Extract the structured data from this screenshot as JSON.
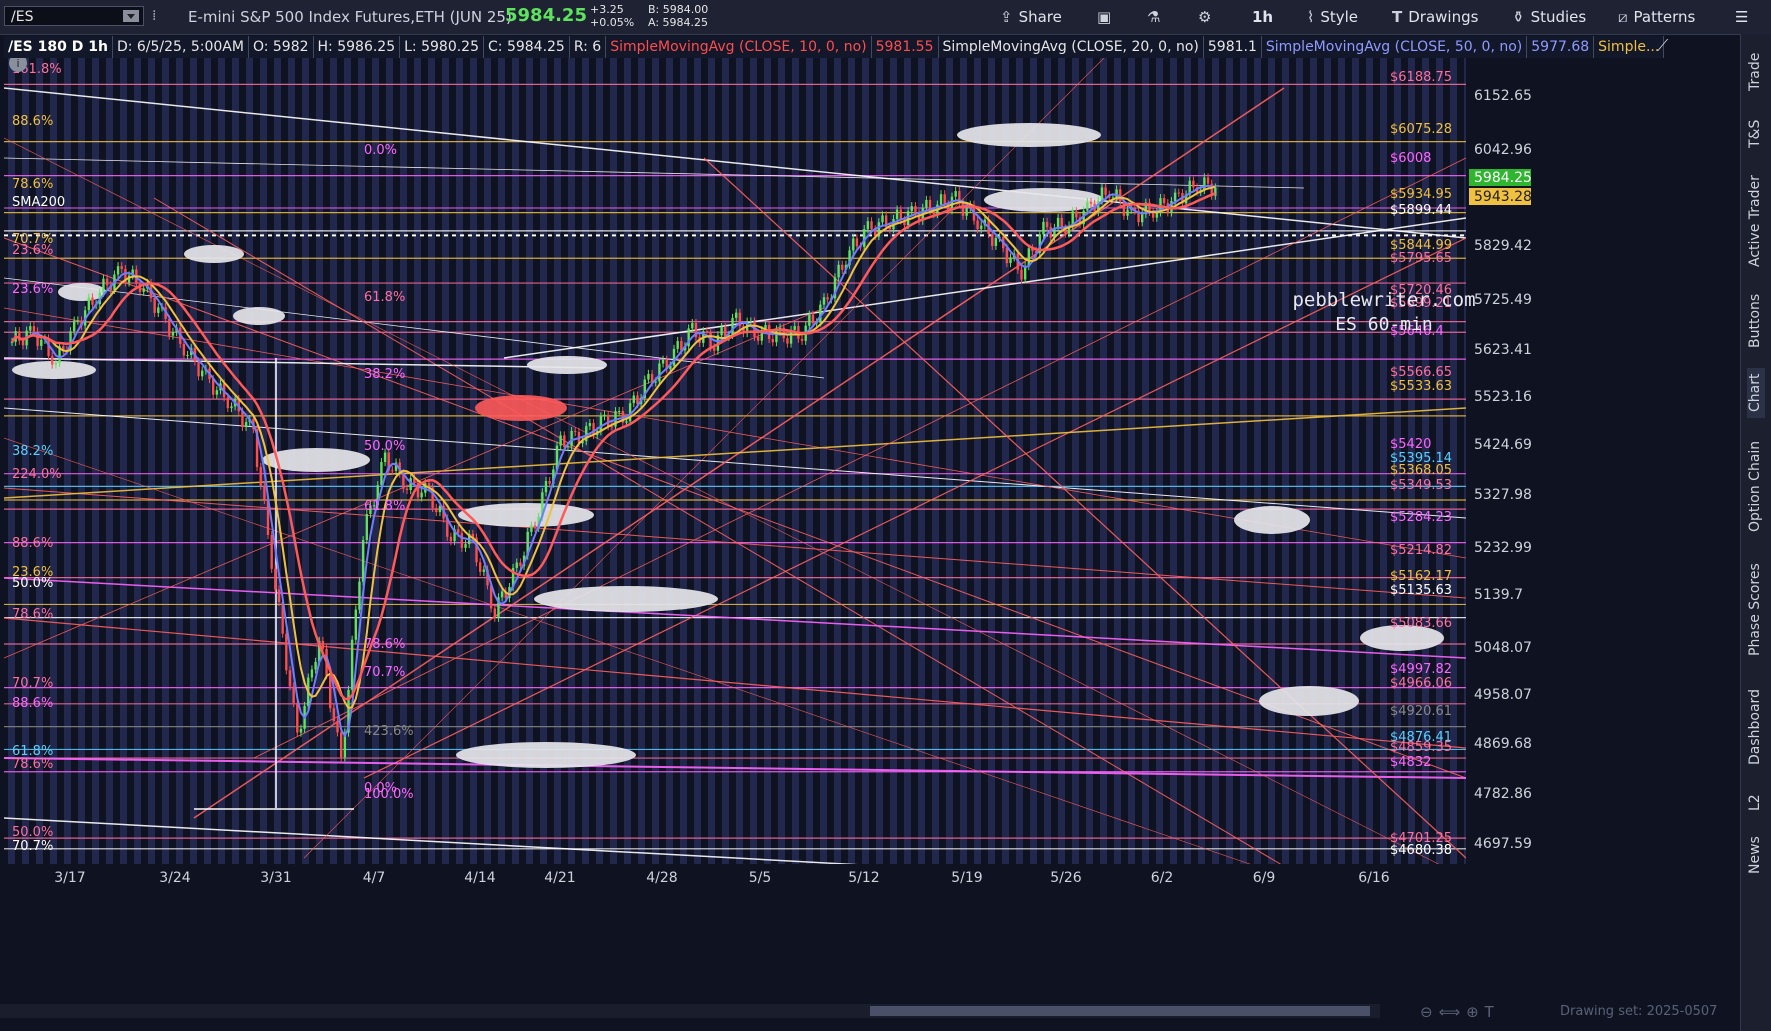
{
  "toolbar": {
    "symbol": "/ES",
    "description": "E-mini S&P 500 Index Futures,ETH (JUN 25)",
    "last_price": "5984.25",
    "change_abs": "+3.25",
    "change_pct": "+0.05%",
    "bid": "B: 5984.00",
    "ask": "A: 5984.25",
    "share_label": "Share",
    "interval_label": "1h",
    "style_label": "Style",
    "drawings_label": "Drawings",
    "studies_label": "Studies",
    "patterns_label": "Patterns"
  },
  "infobar": {
    "name": "/ES 180 D 1h",
    "date": "D: 6/5/25, 5:00AM",
    "open": "O: 5982",
    "high": "H: 5986.25",
    "low": "L: 5980.25",
    "close": "C: 5984.25",
    "range": "R: 6",
    "sma10_label": "SimpleMovingAvg (CLOSE, 10, 0, no)",
    "sma10_value": "5981.55",
    "sma20_label": "SimpleMovingAvg (CLOSE, 20, 0, no)",
    "sma20_value": "5981.1",
    "sma50_label": "SimpleMovingAvg (CLOSE, 50, 0, no)",
    "sma50_value": "5977.68",
    "sma_more": "Simple..."
  },
  "chart": {
    "watermark_1": "pebblewriter.com",
    "watermark_2": "ES 60-min",
    "price_labels": [
      "6152.65",
      "6042.96",
      "5829.42",
      "5725.49",
      "5623.41",
      "5523.16",
      "5424.69",
      "5327.98",
      "5232.99",
      "5139.7",
      "5048.07",
      "4958.07",
      "4869.68",
      "4782.86",
      "4697.59"
    ],
    "date_labels": [
      "3/17",
      "3/24",
      "3/31",
      "4/7",
      "4/14",
      "4/21",
      "4/28",
      "5/5",
      "5/12",
      "5/19",
      "5/26",
      "6/2",
      "6/9",
      "6/16"
    ],
    "current_price_tag": "5984.25",
    "sma_tag": "5943.28",
    "level_labels": [
      {
        "t": "$6188.75",
        "c": "#ff6fa0"
      },
      {
        "t": "$6075.28",
        "c": "#f0c040"
      },
      {
        "t": "$6008",
        "c": "#ff66ff"
      },
      {
        "t": "$5934.95",
        "c": "#f0c040"
      },
      {
        "t": "$5899.44",
        "c": "#ffffff"
      },
      {
        "t": "$5844.99",
        "c": "#f0c040"
      },
      {
        "t": "$5795.65",
        "c": "#ff6fa0"
      },
      {
        "t": "$5720.46",
        "c": "#ff6fa0"
      },
      {
        "t": "$5699.21",
        "c": "#ff6fa0"
      },
      {
        "t": "$5646.4",
        "c": "#ff66ff"
      },
      {
        "t": "$5566.65",
        "c": "#ff6fa0"
      },
      {
        "t": "$5533.63",
        "c": "#f0c040"
      },
      {
        "t": "$5420",
        "c": "#ff66ff"
      },
      {
        "t": "$5395.14",
        "c": "#5ad0ff"
      },
      {
        "t": "$5368.05",
        "c": "#f0c040"
      },
      {
        "t": "$5349.53",
        "c": "#ff6fa0"
      },
      {
        "t": "$5284.23",
        "c": "#ff66ff"
      },
      {
        "t": "$5214.82",
        "c": "#ff6fa0"
      },
      {
        "t": "$5162.17",
        "c": "#f0c040"
      },
      {
        "t": "$5135.63",
        "c": "#ffffff"
      },
      {
        "t": "$5083.66",
        "c": "#ff6fa0"
      },
      {
        "t": "$4997.82",
        "c": "#ff66ff"
      },
      {
        "t": "$4966.06",
        "c": "#ff6fa0"
      },
      {
        "t": "$4920.61",
        "c": "#888888"
      },
      {
        "t": "$4876.41",
        "c": "#5ad0ff"
      },
      {
        "t": "$4859.35",
        "c": "#ff6fa0"
      },
      {
        "t": "$4832",
        "c": "#ff66ff"
      },
      {
        "t": "$4701.25",
        "c": "#ff6fa0"
      },
      {
        "t": "$4680.38",
        "c": "#ffffff"
      }
    ],
    "fib_labels": [
      {
        "t": "161.8%",
        "c": "#ff6fa0"
      },
      {
        "t": "88.6%",
        "c": "#f0c040"
      },
      {
        "t": "0.0%",
        "c": "#ff66ff"
      },
      {
        "t": "78.6%",
        "c": "#f0c040"
      },
      {
        "t": "SMA200",
        "c": "#ffffff"
      },
      {
        "t": "70.7%",
        "c": "#f0c040"
      },
      {
        "t": "23.6%",
        "c": "#ff6fa0"
      },
      {
        "t": "23.6%",
        "c": "#ff66ff"
      },
      {
        "t": "61.8%",
        "c": "#ff6fa0"
      },
      {
        "t": "38.2%",
        "c": "#ff66ff"
      },
      {
        "t": "50.0%",
        "c": "#ff66ff"
      },
      {
        "t": "38.2%",
        "c": "#5ad0ff"
      },
      {
        "t": "224.0%",
        "c": "#ff6fa0"
      },
      {
        "t": "61.8%",
        "c": "#ff66ff"
      },
      {
        "t": "88.6%",
        "c": "#ff6fa0"
      },
      {
        "t": "23.6%",
        "c": "#f0c040"
      },
      {
        "t": "50.0%",
        "c": "#ffffff"
      },
      {
        "t": "78.6%",
        "c": "#ff6fa0"
      },
      {
        "t": "78.6%",
        "c": "#ff66ff"
      },
      {
        "t": "70.7%",
        "c": "#ff66ff"
      },
      {
        "t": "70.7%",
        "c": "#ff6fa0"
      },
      {
        "t": "88.6%",
        "c": "#ff66ff"
      },
      {
        "t": "423.6%",
        "c": "#888888"
      },
      {
        "t": "61.8%",
        "c": "#5ad0ff"
      },
      {
        "t": "78.6%",
        "c": "#ff6fa0"
      },
      {
        "t": "0.0%",
        "c": "#ff66ff"
      },
      {
        "t": "100.0%",
        "c": "#ff66ff"
      },
      {
        "t": "50.0%",
        "c": "#ff6fa0"
      },
      {
        "t": "70.7%",
        "c": "#ffffff"
      }
    ],
    "drawing_set": "Drawing set: 2025-0507"
  },
  "right_tabs": [
    "Trade",
    "T&S",
    "Active Trader",
    "Buttons",
    "Chart",
    "Option Chain",
    "Phase Scores",
    "Dashboard",
    "L2",
    "News"
  ],
  "colors": {
    "up": "#5de35d",
    "down": "#ff4d4d",
    "sma10": "#ff4d4d",
    "sma20": "#f0c040",
    "sma50": "#6f7dff",
    "accent": "#ff66ff"
  }
}
